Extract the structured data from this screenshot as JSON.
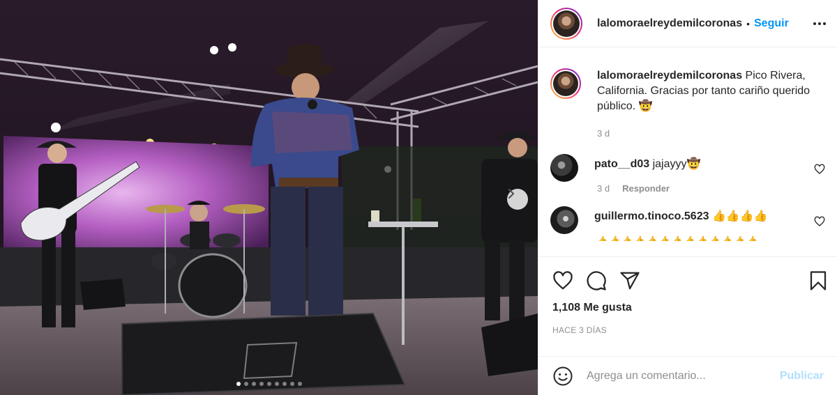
{
  "post": {
    "username": "lalomoraelreydemilcoronas",
    "separator": "•",
    "follow_label": "Seguir",
    "caption_text": "Pico Rivera, California. Gracias por tanto cariño querido público. 🤠",
    "caption_age": "3 d"
  },
  "comments": [
    {
      "username": "pato__d03",
      "text": "jajayyy🤠",
      "age": "3 d",
      "reply_label": "Responder"
    },
    {
      "username": "guillermo.tinoco.5623",
      "text": "👍👍👍👍",
      "overflow_line": "👍👍👍👍👍👍👍👍👍👍👍👍👍"
    }
  ],
  "stats": {
    "likes": "1,108 Me gusta",
    "timestamp": "HACE 3 DÍAS"
  },
  "composer": {
    "placeholder": "Agrega un comentario...",
    "post_label": "Publicar"
  },
  "carousel": {
    "slide_count": 9,
    "active_index": 0
  },
  "colors": {
    "accent": "#0095f6",
    "post_disabled": "#b2dffc",
    "muted": "#8e8e8e",
    "text": "#262626"
  },
  "icons": [
    "heart-icon",
    "comment-icon",
    "share-icon",
    "bookmark-icon",
    "emoji-icon",
    "more-icon",
    "chevron-right-icon"
  ]
}
